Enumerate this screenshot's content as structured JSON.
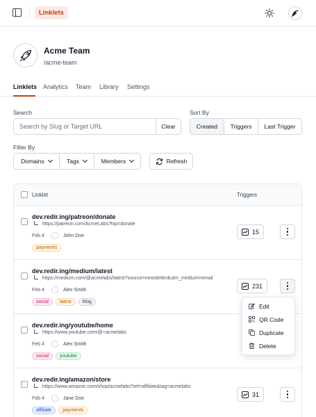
{
  "topbar": {
    "brand": "Linklets"
  },
  "team": {
    "name": "Acme Team",
    "slug": "/acme-team"
  },
  "tabs": [
    {
      "label": "Linklets",
      "active": true
    },
    {
      "label": "Analytics",
      "active": false
    },
    {
      "label": "Team",
      "active": false
    },
    {
      "label": "Library",
      "active": false
    },
    {
      "label": "Settings",
      "active": false
    }
  ],
  "search": {
    "label": "Search",
    "placeholder": "Search by Slug or Target URL",
    "value": "",
    "clear_label": "Clear"
  },
  "sort": {
    "label": "Sort By",
    "options": [
      "Created",
      "Triggers",
      "Last Trigger"
    ],
    "selected": "Created"
  },
  "filter": {
    "label": "Filter By",
    "domains": "Domains",
    "tags": "Tags",
    "members": "Members",
    "refresh": "Refresh"
  },
  "table": {
    "col_linklet": "Linklet",
    "col_triggers": "Triggers",
    "rows": [
      {
        "slug": "dev.redir.ing/patreon/donate",
        "target": "https://patreon.com/AcmeLabs?txp=donate",
        "date": "Feb 4",
        "owner": "John Doe",
        "tags": [
          "payments"
        ],
        "triggers": "15"
      },
      {
        "slug": "dev.redir.ing/medium/latest",
        "target": "https://medium.com/@acmelabs/latest?source=newsletter&utm_medium=email",
        "date": "Feb 4",
        "owner": "Alex Smith",
        "tags": [
          "social",
          "latest",
          "blog"
        ],
        "triggers": "231"
      },
      {
        "slug": "dev.redir.ing/youtube/home",
        "target": "https://www.youtube.com/@+acmelabs",
        "date": "Feb 4",
        "owner": "Alex Smith",
        "tags": [
          "social",
          "youtube"
        ],
        "triggers": ""
      },
      {
        "slug": "dev.redir.ing/amazon/store",
        "target": "https://www.amazon.com/shop/acmelabs?ref=affiliate&tag=acmelabs",
        "date": "Feb 4",
        "owner": "Jane Doe",
        "tags": [
          "affiliate",
          "payments"
        ],
        "triggers": "31"
      }
    ]
  },
  "row_menu": {
    "items": [
      {
        "label": "Edit",
        "icon": "edit-icon"
      },
      {
        "label": "QR Code",
        "icon": "qr-code-icon"
      },
      {
        "label": "Duplicate",
        "icon": "duplicate-icon"
      },
      {
        "label": "Delete",
        "icon": "trash-icon"
      }
    ]
  },
  "colors": {
    "accent": "#c2410c",
    "accent_bg": "#fde8e3"
  }
}
